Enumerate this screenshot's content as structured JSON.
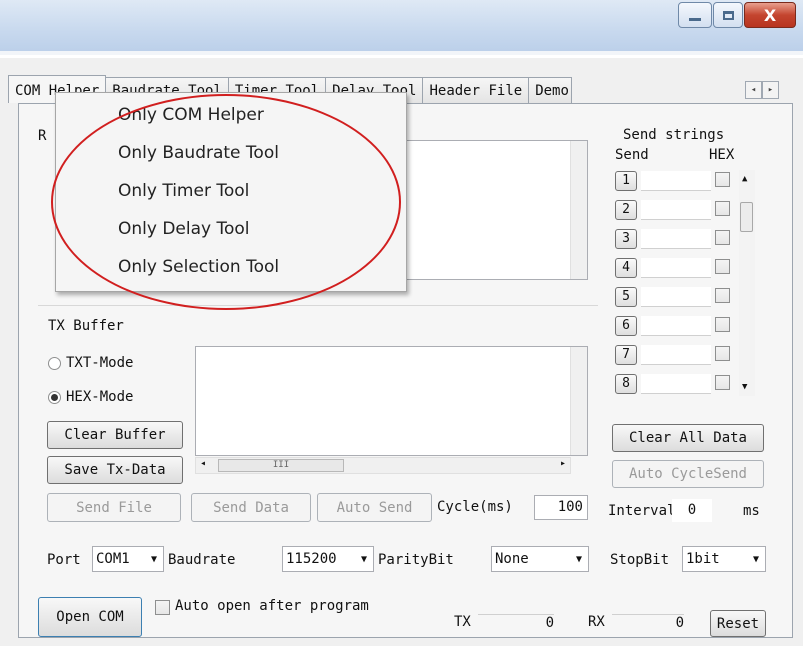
{
  "window": {
    "minimize_icon": "minimize-icon",
    "maximize_icon": "maximize-icon",
    "close_label": "X"
  },
  "tabs": [
    "COM Helper",
    "Baudrate Tool",
    "Timer Tool",
    "Delay Tool",
    "Header File",
    "Demo"
  ],
  "tab_scroll": {
    "left": "◂",
    "right": "▸"
  },
  "popup_menu": [
    "Only COM Helper",
    "Only Baudrate Tool",
    "Only Timer Tool",
    "Only Delay Tool",
    "Only Selection Tool"
  ],
  "tx": {
    "title": "TX Buffer",
    "txt_mode": "TXT-Mode",
    "hex_mode": "HEX-Mode",
    "hex_selected": true,
    "clear_buffer": "Clear Buffer",
    "save_tx": "Save Tx-Data",
    "hscroll_grip": "III"
  },
  "actions": {
    "send_file": "Send File",
    "send_data": "Send Data",
    "auto_send": "Auto Send",
    "cycle_label": "Cycle(ms)",
    "cycle_value": "100"
  },
  "send_strings": {
    "title": "Send strings",
    "col_send": "Send",
    "col_hex": "HEX",
    "rows": [
      "1",
      "2",
      "3",
      "4",
      "5",
      "6",
      "7",
      "8"
    ],
    "clear_all": "Clear All Data",
    "auto_cycle": "Auto CycleSend",
    "interval_label": "Interval",
    "interval_value": "0",
    "interval_unit": "ms"
  },
  "port": {
    "port_label": "Port",
    "port_value": "COM1",
    "baud_label": "Baudrate",
    "baud_value": "115200",
    "parity_label": "ParityBit",
    "parity_value": "None",
    "stop_label": "StopBit",
    "stop_value": "1bit"
  },
  "bottom": {
    "open_com": "Open COM",
    "auto_open": "Auto open after program",
    "tx_label": "TX",
    "tx_value": "0",
    "rx_label": "RX",
    "rx_value": "0",
    "reset": "Reset"
  },
  "hidden_fragment": "R"
}
